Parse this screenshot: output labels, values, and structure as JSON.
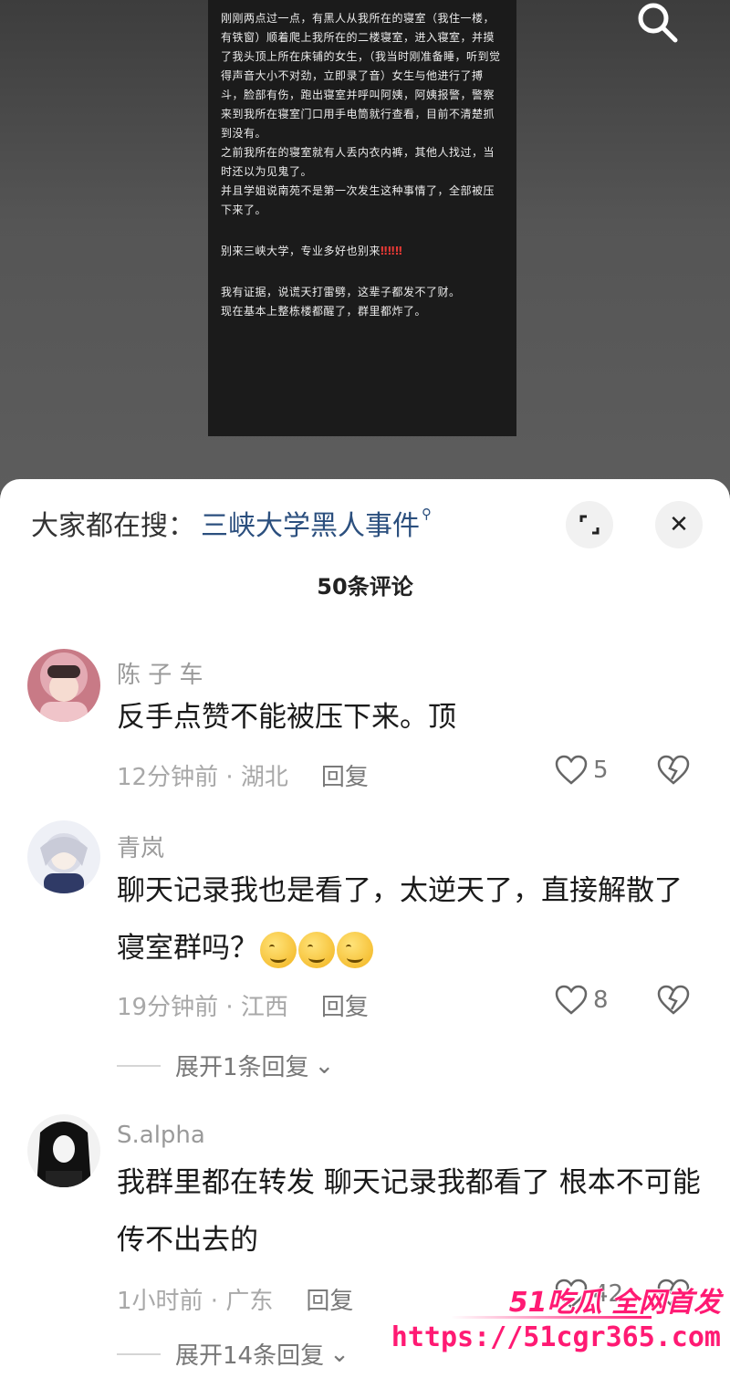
{
  "screenshot_text": [
    "刚刚两点过一点，有黑人从我所在的寝室（我住一楼，有铁窗）顺着爬上我所在的二楼寝室，进入寝室，并摸了我头顶上所在床铺的女生，（我当时刚准备睡，听到觉得声音大小不对劲，立即录了音）女生与他进行了搏斗，脸部有伤，跑出寝室并呼叫阿姨，阿姨报警，警察来到我所在寝室门口用手电筒就行查看，目前不清楚抓到没有。",
    "之前我所在的寝室就有人丢内衣内裤，其他人找过，当时还以为见鬼了。",
    "并且学姐说南苑不是第一次发生这种事情了，全部被压下来了。",
    "",
    "别来三峡大学，专业多好也别来",
    "",
    "我有证据，说谎天打雷劈，这辈子都发不了财。",
    "现在基本上整栋楼都醒了，群里都炸了。"
  ],
  "screenshot_bang": "‼‼‼",
  "sheet": {
    "hot_prefix": "大家都在搜：",
    "hot_link": "三峡大学黑人事件",
    "comment_count": "50条评论"
  },
  "comments": [
    {
      "name": "陈 子 车",
      "text": "反手点赞不能被压下来。顶",
      "time": "12分钟前 · 湖北",
      "reply": "回复",
      "likes": "5"
    },
    {
      "name": "青岚",
      "text": "聊天记录我也是看了，太逆天了，直接解散了寝室群吗？",
      "time": "19分钟前 · 江西",
      "reply": "回复",
      "likes": "8",
      "expand": "展开1条回复"
    },
    {
      "name": "S.alpha",
      "text": "我群里都在转发 聊天记录我都看了 根本不可能传不出去的",
      "time": "1小时前 · 广东",
      "reply": "回复",
      "likes": "42",
      "expand": "展开14条回复"
    }
  ],
  "watermark": {
    "brand": "51吃瓜 全网首发",
    "url": "https://51cgr365.com"
  },
  "colors": {
    "link": "#2b4f7e",
    "watermark": "#ff1a73"
  }
}
